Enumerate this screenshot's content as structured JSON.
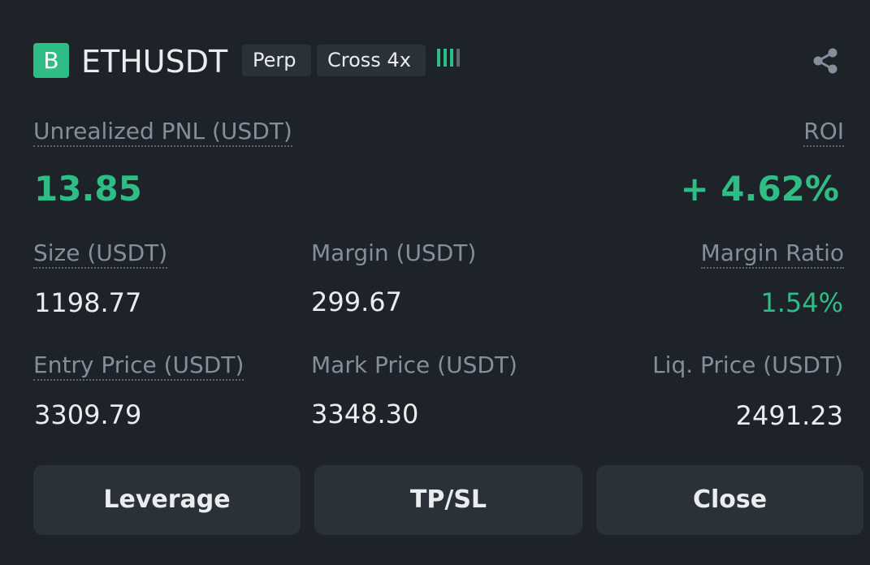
{
  "header": {
    "side_badge": "B",
    "symbol": "ETHUSDT",
    "contract_type": "Perp",
    "margin_mode": "Cross 4x",
    "icons": {
      "share": "share-icon",
      "risk_indicator": "signal-strength-icon"
    }
  },
  "pnl": {
    "label": "Unrealized PNL (USDT)",
    "value": "13.85",
    "roi_label": "ROI",
    "roi_value": "+ 4.62%"
  },
  "row1": {
    "size_label": "Size (USDT)",
    "size_value": "1198.77",
    "margin_label": "Margin (USDT)",
    "margin_value": "299.67",
    "margin_ratio_label": "Margin Ratio",
    "margin_ratio_value": "1.54%"
  },
  "row2": {
    "entry_label": "Entry Price (USDT)",
    "entry_value": "3309.79",
    "mark_label": "Mark Price (USDT)",
    "mark_value": "3348.30",
    "liq_label": "Liq. Price (USDT)",
    "liq_value": "2491.23"
  },
  "buttons": {
    "leverage": "Leverage",
    "tpsl": "TP/SL",
    "close": "Close"
  },
  "colors": {
    "background": "#1e2329",
    "positive": "#2ebd85",
    "label": "#848e9c",
    "text": "#eaecef",
    "button_bg": "#2b3139"
  }
}
